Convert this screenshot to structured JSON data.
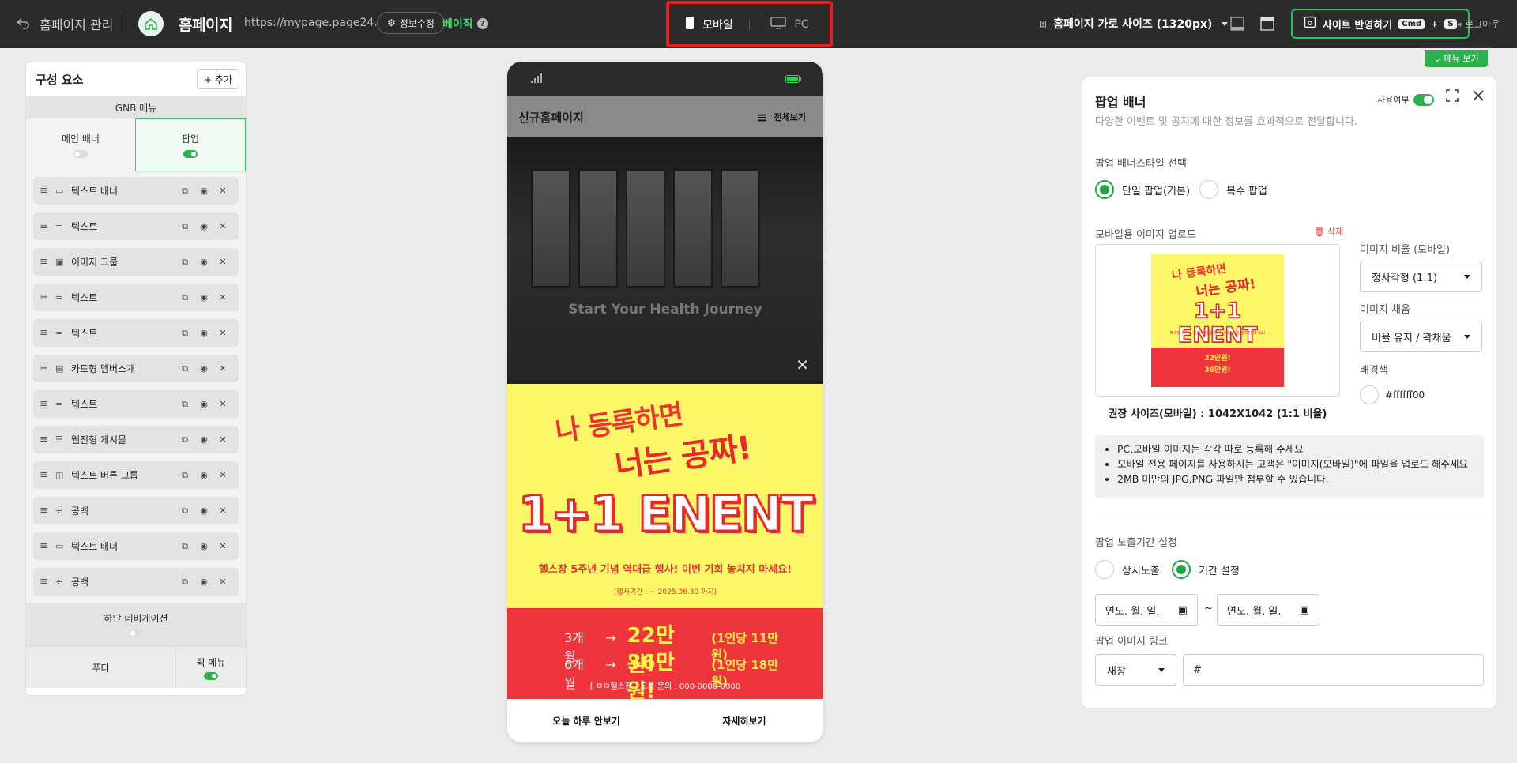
{
  "topbar": {
    "back_label": "홈페이지 관리",
    "site_name": "홈페이지",
    "url": "https://mypage.page24.app",
    "info_edit_label": "정보수정",
    "plan": "베이직",
    "help": "?",
    "device_mobile": "모바일",
    "device_pc": "PC",
    "size_label": "홈페이지 가로 사이즈 (1320px)",
    "publish_label": "사이트 반영하기",
    "shortcut_key1": "Cmd",
    "shortcut_plus": "+",
    "shortcut_key2": "S",
    "logout": "로그아웃"
  },
  "left_panel": {
    "title": "구성 요소",
    "add_label": "+ 추가",
    "gnb": "GNB 메뉴",
    "main_banner": "메인 배너",
    "popup": "팝업",
    "components": [
      {
        "label": "텍스트 배너",
        "icon": "▭"
      },
      {
        "label": "텍스트",
        "icon": "="
      },
      {
        "label": "이미지 그룹",
        "icon": "▣"
      },
      {
        "label": "텍스트",
        "icon": "="
      },
      {
        "label": "텍스트",
        "icon": "="
      },
      {
        "label": "카드형 멤버소개",
        "icon": "▤"
      },
      {
        "label": "텍스트",
        "icon": "="
      },
      {
        "label": "웹진형 게시물",
        "icon": "☰"
      },
      {
        "label": "텍스트 버튼 그룹",
        "icon": "◫"
      },
      {
        "label": "공백",
        "icon": "÷"
      },
      {
        "label": "텍스트 배너",
        "icon": "▭"
      },
      {
        "label": "공백",
        "icon": "÷"
      }
    ],
    "bottom_nav": "하단 네비게이션",
    "footer": "푸터",
    "quick_menu": "퀵 메뉴"
  },
  "phone": {
    "title": "신규홈페이지",
    "menu": "전체보기",
    "hero_text": "Start Your Health Journey",
    "banner": {
      "line1": "나 등록하면",
      "line2": "너는 공짜!",
      "big": "1+1 ENENT",
      "desc": "헬스장 5주년 기념 역대급 행사! 이번 기회 놓치지 마세요!",
      "period": "(행사기간 : ~ 2025.06.30 까지)",
      "prices": [
        {
          "months": "3개월",
          "arrow": "→",
          "price": "22만원!",
          "per": "(1인당 11만원)"
        },
        {
          "months": "6개월",
          "arrow": "→",
          "price": "36만원!",
          "per": "(1인당 18만원)"
        }
      ],
      "contact": "[ ㅁㅁ헬스장 ] 모든 문의 : 000-0000-0000"
    },
    "no_today": "오늘 하루 안보기",
    "details": "자세히보기"
  },
  "right_panel": {
    "menu_view": "메뉴 보기",
    "title": "팝업 배너",
    "subtitle": "다양한 이벤트 및 공지에 대한 정보를 효과적으로 전달합니다.",
    "use_label": "사용여부",
    "style_label": "팝업 배너스타일 선택",
    "single": "단일 팝업(기본)",
    "multi": "복수 팝업",
    "upload_label": "모바일용 이미지 업로드",
    "delete": "삭제",
    "ratio_label": "이미지 비율 (모바일)",
    "ratio_value": "정사각형 (1:1)",
    "fill_label": "이미지 채움",
    "fill_value": "비율 유지 / 꽉채움",
    "bg_label": "배경색",
    "bg_value": "#ffffff00",
    "rec_size": "권장 사이즈(모바일) : 1042X1042 (1:1 비율)",
    "notes": [
      "PC,모바일 이미지는 각각 따로 등록해 주세요",
      "모바일 전용 페이지를 사용하시는 고객은 \"이미지(모바일)\"에 파일을 업로드 해주세요",
      "2MB 미만의 JPG,PNG 파일만 첨부할 수 있습니다."
    ],
    "period_label": "팝업 노출기간 설정",
    "always": "상시노출",
    "set_period": "기간 설정",
    "date_placeholder": "연도. 월. 일.",
    "tilde": "~",
    "link_label": "팝업 이미지 링크",
    "link_target": "새창",
    "link_value": "#"
  },
  "colors": {
    "accent_green": "#22c55e",
    "highlight_red": "#e02020",
    "banner_yellow": "#fbf767",
    "banner_red": "#f0343b"
  }
}
